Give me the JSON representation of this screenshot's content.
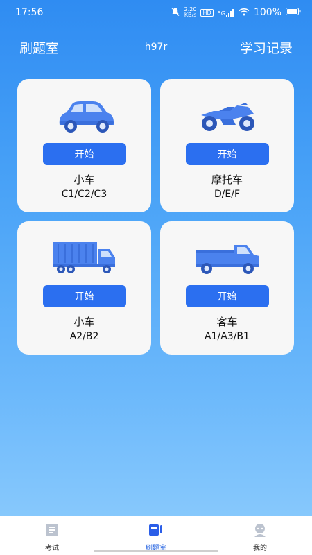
{
  "status": {
    "time": "17:56",
    "speed_top": "2.20",
    "speed_bottom": "KB/s",
    "hd": "HD",
    "network": "5G",
    "battery": "100%"
  },
  "header": {
    "left": "刷题室",
    "mid": "h97r",
    "right": "学习记录"
  },
  "cards": [
    {
      "title": "小车",
      "sub": "C1/C2/C3",
      "button": "开始",
      "icon": "car-icon"
    },
    {
      "title": "摩托车",
      "sub": "D/E/F",
      "button": "开始",
      "icon": "motorcycle-icon"
    },
    {
      "title": "小车",
      "sub": "A2/B2",
      "button": "开始",
      "icon": "truck-icon"
    },
    {
      "title": "客车",
      "sub": "A1/A3/B1",
      "button": "开始",
      "icon": "pickup-truck-icon"
    }
  ],
  "tabs": [
    {
      "label": "考试",
      "icon": "exam-icon"
    },
    {
      "label": "刷题室",
      "icon": "practice-icon"
    },
    {
      "label": "我的",
      "icon": "profile-icon"
    }
  ],
  "colors": {
    "accent": "#2b6ff0",
    "card": "#f7f7f7",
    "icon": "#4b82ee"
  }
}
